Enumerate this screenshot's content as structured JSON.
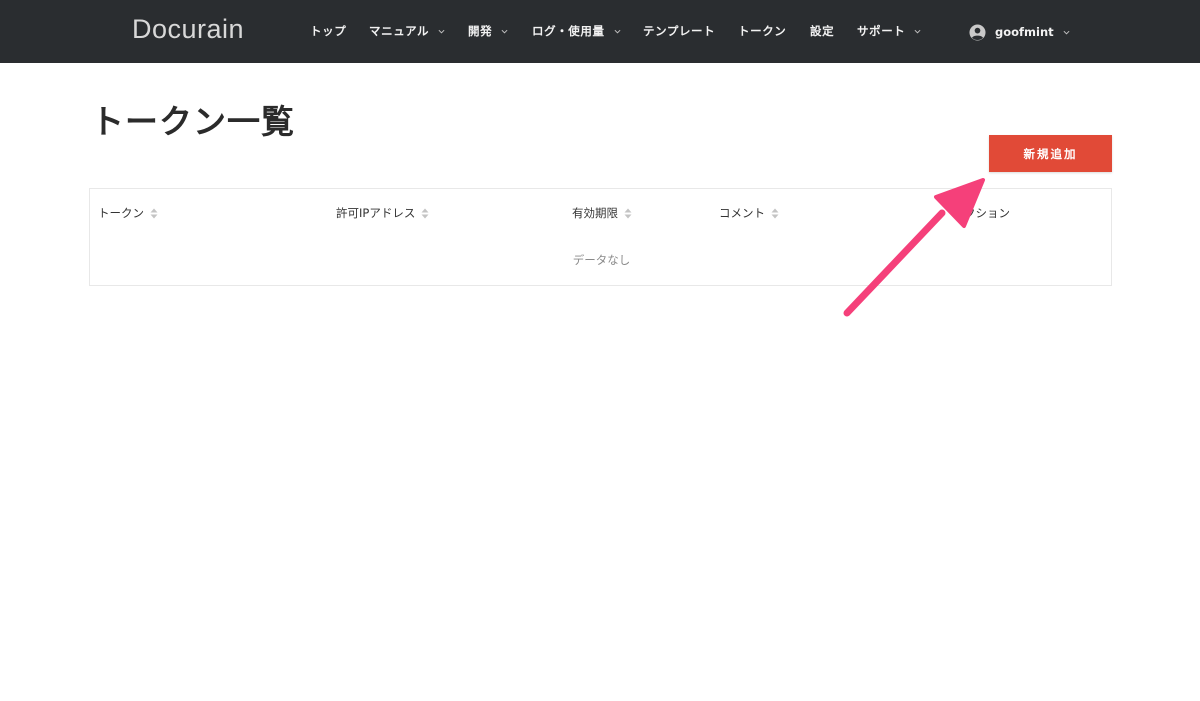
{
  "app": {
    "logo": "Docurain"
  },
  "nav": {
    "items": [
      {
        "label": "トップ",
        "dropdown": false
      },
      {
        "label": "マニュアル",
        "dropdown": true
      },
      {
        "label": "開発",
        "dropdown": true
      },
      {
        "label": "ログ・使用量",
        "dropdown": true
      },
      {
        "label": "テンプレート",
        "dropdown": false
      },
      {
        "label": "トークン",
        "dropdown": false
      },
      {
        "label": "設定",
        "dropdown": false
      },
      {
        "label": "サポート",
        "dropdown": true
      }
    ],
    "user": {
      "name": "goofmint",
      "icon": "user-circle-icon"
    }
  },
  "page": {
    "title": "トークン一覧",
    "add_button_label": "新規追加"
  },
  "table": {
    "columns": [
      "トークン",
      "許可IPアドレス",
      "有効期限",
      "コメント",
      "アクション"
    ],
    "visible_last_column_text": "クション",
    "empty_text": "データなし"
  },
  "annotation": {
    "arrow_color": "#f5407a"
  },
  "colors": {
    "navbar_bg": "#2a2d30",
    "accent_button": "#e14a37"
  }
}
